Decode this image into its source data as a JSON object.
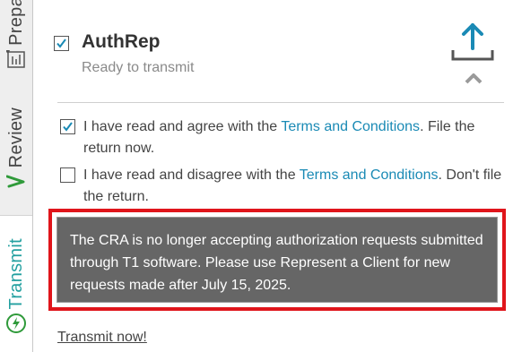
{
  "sidebar": {
    "tabs": [
      {
        "label": "Prepa"
      },
      {
        "label": "Review"
      },
      {
        "label": "Transmit"
      }
    ]
  },
  "panel": {
    "title": "AuthRep",
    "status": "Ready to transmit",
    "title_checked": true,
    "options": [
      {
        "checked": true,
        "before": "I have read and agree with the ",
        "link": "Terms and Conditions",
        "after": ". File the return now."
      },
      {
        "checked": false,
        "before": "I have read and disagree with the ",
        "link": "Terms and Conditions",
        "after": ". Don't file the return."
      }
    ],
    "notice": "The CRA is no longer accepting authorization requests submitted through T1 software. Please use Represent a Client for new requests made after July 15, 2025.",
    "transmit_link": "Transmit now!"
  },
  "colors": {
    "accent": "#1a8ab5",
    "notice_bg": "#666666",
    "highlight_border": "#e0151b",
    "transmit_green": "#23a0a0"
  },
  "icons": [
    "prepare-form-icon",
    "review-check-icon",
    "transmit-lightning-icon",
    "upload-icon",
    "chevron-up-icon",
    "checkbox-check-icon"
  ]
}
